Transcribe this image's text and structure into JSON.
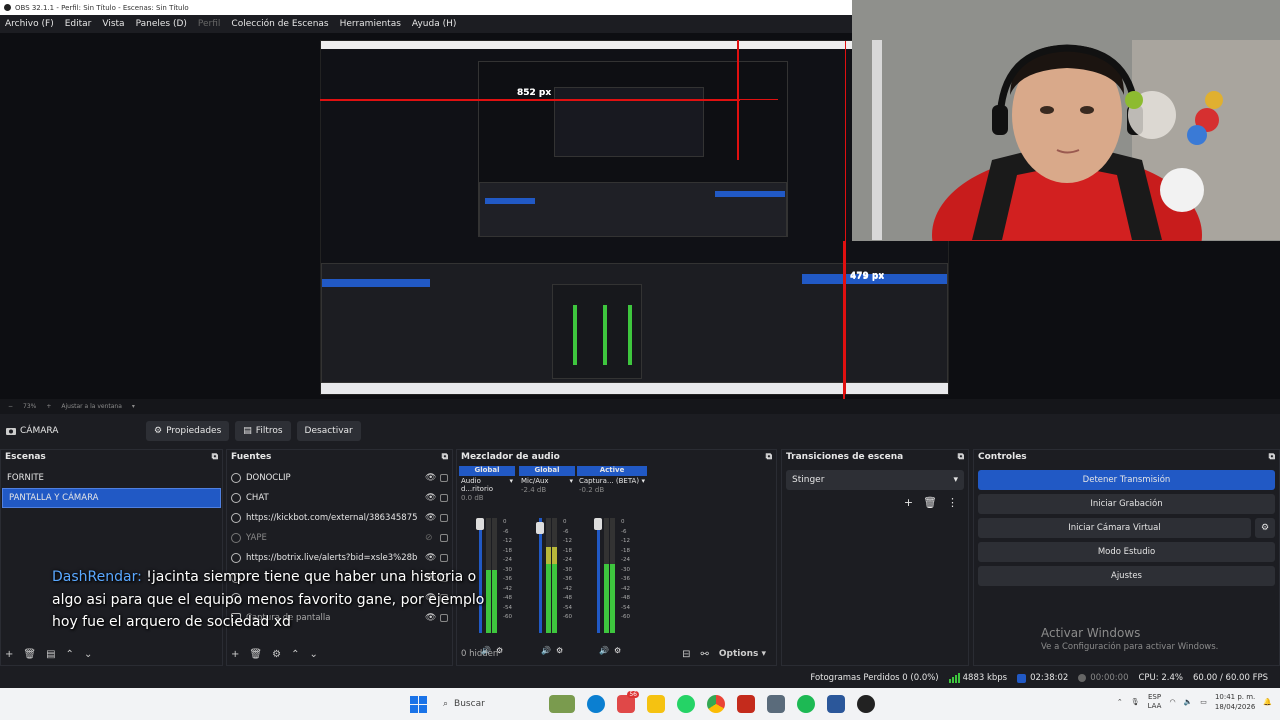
{
  "window": {
    "title": "OBS 32.1.1 - Perfil: Sin Título - Escenas: Sin Título"
  },
  "menu": {
    "items": [
      {
        "label": "Archivo (F)",
        "enabled": true
      },
      {
        "label": "Editar",
        "enabled": true
      },
      {
        "label": "Vista",
        "enabled": true
      },
      {
        "label": "Paneles (D)",
        "enabled": true
      },
      {
        "label": "Perfil",
        "enabled": false
      },
      {
        "label": "Colección de Escenas",
        "enabled": true
      },
      {
        "label": "Herramientas",
        "enabled": true
      },
      {
        "label": "Ayuda (H)",
        "enabled": true
      }
    ]
  },
  "preview": {
    "width_label": "852 px",
    "height_label": "479 px",
    "inner_width_label": "852 px",
    "inner_height_label": "479 px"
  },
  "zoom": {
    "level": "73%",
    "fit_label": "Ajustar a la ventana"
  },
  "context": {
    "source_label": "CÁMARA",
    "properties": "Propiedades",
    "filters": "Filtros",
    "deactivate": "Desactivar"
  },
  "scenes": {
    "title": "Escenas",
    "items": [
      {
        "label": "FORNITE",
        "selected": false
      },
      {
        "label": "PANTALLA Y CÁMARA",
        "selected": true
      }
    ]
  },
  "sources": {
    "title": "Fuentes",
    "items": [
      {
        "label": "DONOCLIP",
        "visible": true
      },
      {
        "label": "CHAT",
        "visible": true
      },
      {
        "label": "https://kickbot.com/external/386345875",
        "visible": true
      },
      {
        "label": "YAPE",
        "visible": false
      },
      {
        "label": "https://botrix.live/alerts?bid=xsle3%28b",
        "visible": true
      },
      {
        "label": "",
        "visible": true
      },
      {
        "label": "",
        "visible": true
      },
      {
        "label": "Captura de pantalla",
        "visible": true
      }
    ]
  },
  "mixer": {
    "title": "Mezclador de audio",
    "hidden_count": "0 hidden",
    "options_label": "Options",
    "channels": [
      {
        "badge": "Global",
        "name": "Audio d...ritorio",
        "db": "0.0 dB",
        "level": 0.55
      },
      {
        "badge": "Global",
        "name": "Mic/Aux",
        "db": "-2.4 dB",
        "level": 0.75
      },
      {
        "badge": "Active",
        "name": "Captura... (BETA)",
        "db": "-0.2 dB",
        "level": 0.6
      }
    ],
    "ticks": [
      "0",
      "-6",
      "-12",
      "-18",
      "-24",
      "-30",
      "-36",
      "-42",
      "-48",
      "-54",
      "-60"
    ]
  },
  "transitions": {
    "title": "Transiciones de escena",
    "selected": "Stinger"
  },
  "controls": {
    "title": "Controles",
    "stop_stream": "Detener Transmisión",
    "start_recording": "Iniciar Grabación",
    "start_virtual_cam": "Iniciar Cámara Virtual",
    "studio_mode": "Modo Estudio",
    "settings": "Ajustes"
  },
  "chat_overlay": {
    "user": "DashRendar:",
    "line1": "!jacinta siempre tiene que haber una historia o",
    "line2": "algo asi para que el equipo menos favorito gane, por ejemplo",
    "line3": "hoy fue el arquero de sociedad xd"
  },
  "status": {
    "dropped_frames": "Fotogramas Perdidos 0 (0.0%)",
    "bitrate": "4883 kbps",
    "stream_time": "02:38:02",
    "rec_time": "00:00:00",
    "cpu": "CPU: 2.4%",
    "fps": "60.00 / 60.00 FPS"
  },
  "watermark": {
    "title": "Activar Windows",
    "subtitle": "Ve a Configuración para activar Windows."
  },
  "taskbar": {
    "search_placeholder": "Buscar",
    "badge_count": "56",
    "lang_top": "ESP",
    "lang_bottom": "LAA",
    "time": "10:41 p. m.",
    "date": "18/04/2026"
  },
  "colors": {
    "accent": "#2159c5",
    "red_guide": "#e01010",
    "meter_green": "#3ec63e"
  }
}
